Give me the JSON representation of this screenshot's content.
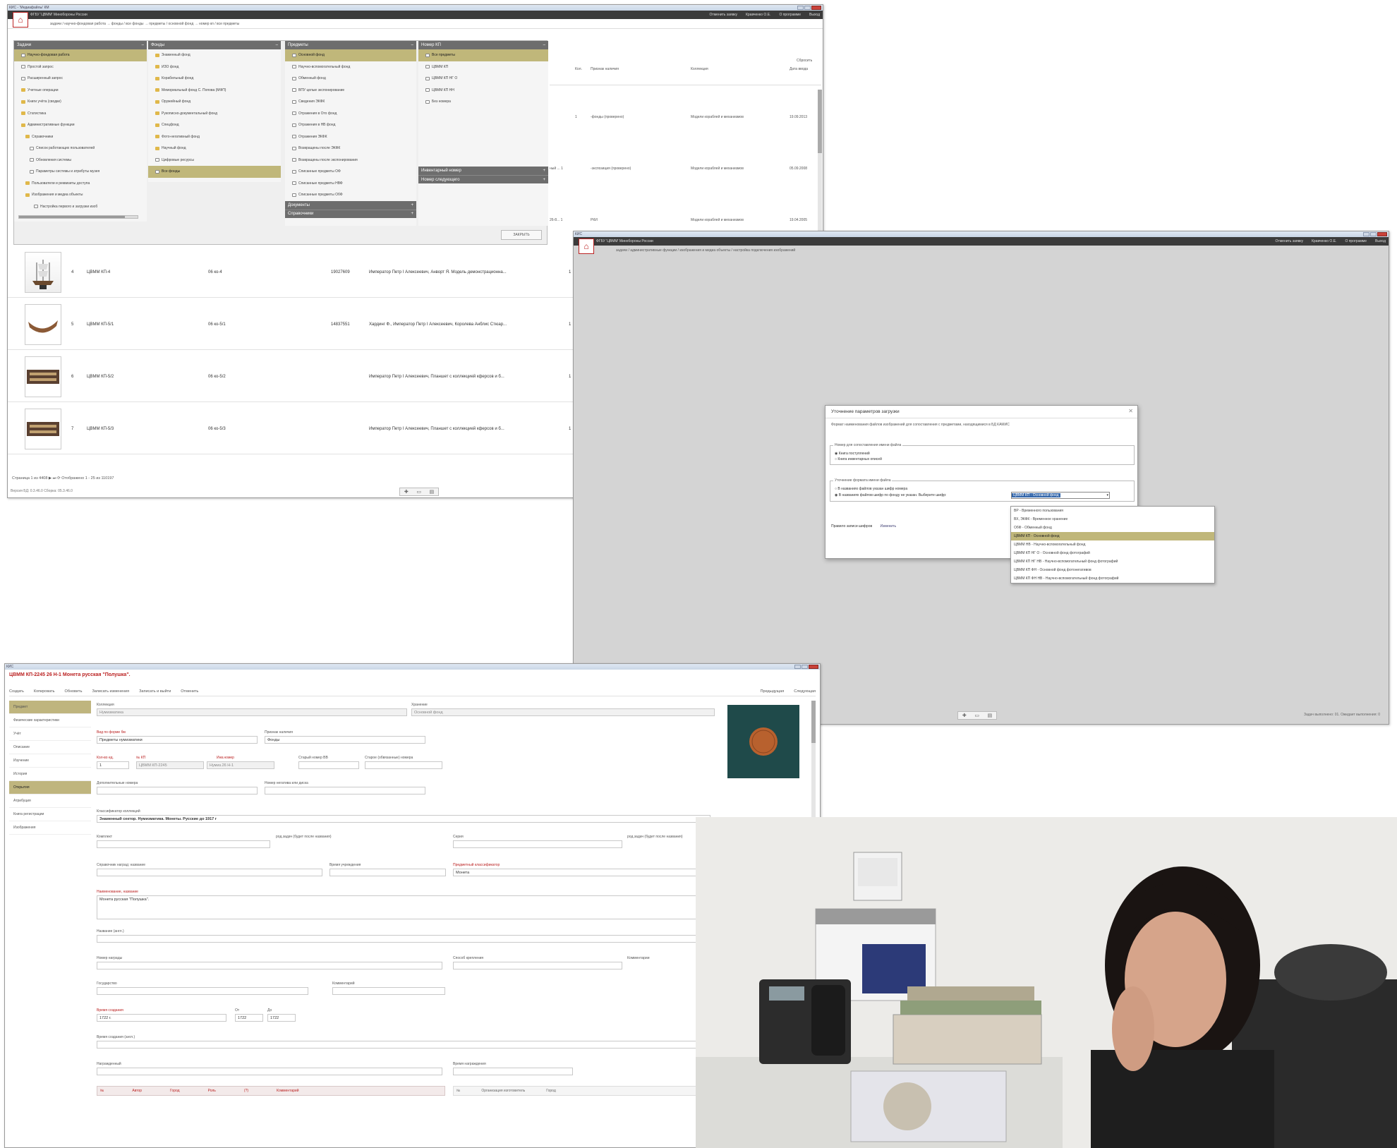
{
  "window1": {
    "title": "КИС - 'Медиафайлы' КМ",
    "app_title": "ФГБУ 'ЦВММ' Минобороны России",
    "header_links": [
      "Отменить заявку",
      "Кравченко О.Е.",
      "О программе",
      "Выход"
    ],
    "breadcrumb": "задачи / научно-фондовая работа → фонды / все фонды → предметы / основной фонд → номер кп / все предметы",
    "panels": {
      "tasks": {
        "title": "Задачи",
        "items": [
          "Научно-фондовая работа",
          "Простой запрос",
          "Расширенный запрос",
          "Учетные операции",
          "Книги учёта (сводки)",
          "Статистика",
          "Административные функции",
          "Справочники",
          "Список работающих пользователей",
          "Обновления системы",
          "Параметры системы и атрибуты музея",
          "Пользователи и реквизиты доступа",
          "Изображения и медиа объекты",
          "Настройка первого и загрузки изоб"
        ]
      },
      "funds": {
        "title": "Фонды",
        "items": [
          "Знаменный фонд",
          "ИЗО фонд",
          "Корабельный фонд",
          "Мемориальный фонд С. Попова (МФП)",
          "Оружейный фонд",
          "Рукописно-документальный фонд",
          "Спецфонд",
          "Фото-негативный фонд",
          "Научный фонд",
          "Цифровые ресурсы",
          "Все фонды"
        ]
      },
      "objects": {
        "title": "Предметы",
        "items": [
          "Основной фонд",
          "Научно-вспомогательный фонд",
          "Обменный фонд",
          "ВПУ целые экспонирование",
          "Сведения ЭКФК",
          "Отражения в Ото фонд",
          "Отражения в НВ фонд",
          "Отражения ЭКФК",
          "Возвращены после ЭКФК",
          "Возвращены после экспонирования",
          "Списанные предметы ОФ",
          "Списанные предметы НВФ",
          "Списанные предметы ОбФ"
        ],
        "sections": [
          "Документы",
          "Справочники"
        ]
      },
      "numbers": {
        "title": "Номер КП",
        "items": [
          "Все предметы",
          "ЦВММ КП",
          "ЦВММ КП НГ О",
          "ЦВММ КП НН",
          "Без номера"
        ],
        "sections": [
          "Инвентарный номер",
          "Номер следующего"
        ]
      }
    },
    "grid_headers": [
      "Кол.",
      "Признак наличия",
      "Коллекция",
      "Дата ввода"
    ],
    "grid_upper_rows": [
      {
        "qty": "1",
        "status": "-фонды (проверено)",
        "collection": "Модели кораблей и механизмов",
        "date": "19.09.2013"
      },
      {
        "qty": "1",
        "status": "-экспозиция (проверено)",
        "collection": "Модели кораблей и механизмов",
        "date": "05.09.2008"
      },
      {
        "qty": "",
        "status": "РКИ",
        "collection": "Модели кораблей и механизмов",
        "date": "19.04.2005"
      }
    ],
    "partial_text": [
      "ный ... 1",
      "26-8... 1"
    ],
    "close_button": "ЗАКРЫТЬ",
    "filter_label": "Сбросить",
    "rows": [
      {
        "n": "4",
        "kp": "ЦВММ КП-4",
        "inv": "06 ко-4",
        "num": "19027609",
        "title": "Император Петр I Алексеевич, Анворт Я. Модель демонстрационна...",
        "qty": "1"
      },
      {
        "n": "5",
        "kp": "ЦВММ КП-5/1",
        "inv": "06 ко-5/1",
        "num": "14837551",
        "title": "Хардинг Ф., Император Петр I Алексеевич, Королева Анблис Стюар...",
        "qty": "1"
      },
      {
        "n": "6",
        "kp": "ЦВММ КП-5/2",
        "inv": "06 ко-5/2",
        "num": "",
        "title": "Император Петр I Алексеевич, Планшет с коллекцией кферсов и б...",
        "qty": "1"
      },
      {
        "n": "7",
        "kp": "ЦВММ КП-5/3",
        "inv": "06 ко-5/3",
        "num": "",
        "title": "Император Петр I Алексеевич, Планшет с коллекцией кферсов и б...",
        "qty": "1"
      }
    ],
    "pager": "Страница 1 из 4408 ▶ ⏭ ⟳ Отображено 1 - 25 из 110197",
    "status": "Версия БД: 0.3.46.0 Сборка: 05.3.46.0"
  },
  "window2": {
    "app_title": "ФГБУ 'ЦВММ' Минобороны России",
    "header_links": [
      "Отменить заявку",
      "Кравченко О.Е.",
      "О программе",
      "Выход"
    ],
    "breadcrumb": "задачи / административные функции / изображения и медиа объекты / настройка подключения изображений",
    "status": "Задач выполнено: 01. Ожидает выполнения: 0",
    "dialog": {
      "title": "Уточнение параметров загрузки",
      "desc": "Формат наименования файлов изображений для сопоставления с предметами, находящимися в БД КАМИС",
      "group1_title": "Номер для сопоставления имени файла",
      "group1_options": [
        "Книга поступлений",
        "Книга инвентарных описей"
      ],
      "group2_title": "Уточнение формата имени файла",
      "group2_options": [
        "В названиях файлов указан шифр номера",
        "В названиях файлов шифр по фонду не указан. Выберите шифр:"
      ],
      "selected_fund": "ЦВММ КП - Основной фонд",
      "rule_label": "Правило записи шифров",
      "rule_link": "Изменить",
      "options": [
        "ВР - Временного пользования",
        "ВХ, ЭКФК - Временное хранение",
        "ОбФ - Обменный фонд",
        "ЦВММ КП - Основной фонд",
        "ЦВММ НВ - Научно-вспомогательный фонд",
        "ЦВММ КП НГ О - Основной фонд фотографий",
        "ЦВММ КП НГ НВ - Научно-вспомогательный фонд фотографий",
        "ЦВММ КП ФН - Основной фонд фотонегативов",
        "ЦВММ КП ФН НВ - Научно-вспомогательный фонд фотографий"
      ]
    }
  },
  "window3": {
    "record_title": "ЦВММ КП-2245 26 Н-1 Монета русская \"Полушка\".",
    "toolbar": [
      "Создать",
      "Копировать",
      "Обновить",
      "Записать изменения",
      "Записать и выйти",
      "Отменить"
    ],
    "nav": [
      "Предыдущая",
      "Следующая"
    ],
    "sidebar": [
      "Предмет",
      "Физические характеристики",
      "Учёт",
      "Описание",
      "Изучение",
      "История",
      "Открытия",
      "Атрибуция",
      "Книга регистрации",
      "Изображения"
    ],
    "sidebar_selected": 6,
    "fields": {
      "collection_label": "Коллекция",
      "collection_value": "Нумизматика",
      "storage_label": "Хранение",
      "storage_value": "Основной фонд",
      "type_label": "Вид по форме бм",
      "type_value": "Предметы нумизматики",
      "presence_label": "Признак наличия",
      "presence_value": "Фонды",
      "qty_label": "Кол-во ед.",
      "qty_value": "1",
      "kp_label": "№ КП",
      "kp_value": "ЦВММ КП-2245",
      "inv_label": "Инв.номер",
      "inv_value": "Нумиз.26 Н-1",
      "old_inv_label": "Старый номер ВВ",
      "old_code_label": "Старое (обвязанные) номера",
      "add_num_label": "Дополнительные номера",
      "neg_label": "Номер негатива или диска",
      "classifier_label": "Классификатор коллекций",
      "classifier_value": "Знаменный сектор. Нумизматика. Монеты. Русские до 1917 г",
      "set_label": "Комплект",
      "subsets_label": "род.задач (будет после названия)",
      "series_label": "Серия",
      "award_label": "Справочник наград: название",
      "era_label": "Время учреждения",
      "subj_label": "Предметный классификатор",
      "subj_value": "Монета",
      "name_label": "Наименование, название",
      "name_value": "Монета русская \"Полушка\".",
      "name_alt_label": "Название (англ.)",
      "award_num_label": "Номер награды",
      "fix_label": "Способ крепления",
      "comment_label": "Комментарии",
      "state_label": "Государство",
      "country_label": "Комментарий",
      "date_label": "Время создания",
      "date_value": "1722 г.",
      "from_label": "От",
      "from_value": "1722",
      "to_label": "До",
      "to_value": "1722",
      "date_alt_label": "Время создания (англ.)",
      "awarded_label": "Награжденный",
      "awarded_time_label": "Время награждения",
      "table_headers": [
        "№",
        "Автор",
        "Город",
        "Роль",
        "(?)",
        "Комментарий"
      ],
      "table2_headers": [
        "№",
        "Организация изготовитель",
        "Город"
      ]
    }
  }
}
